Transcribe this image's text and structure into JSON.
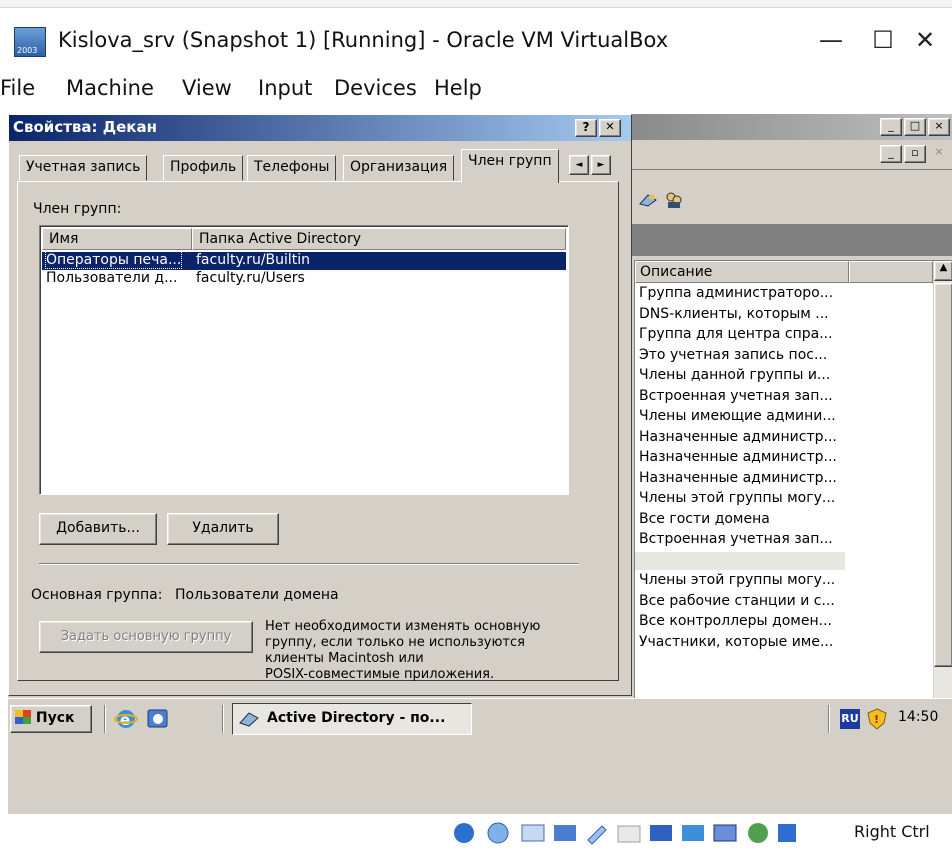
{
  "host": {
    "title": "Kislova_srv (Snapshot 1) [Running] - Oracle VM VirtualBox",
    "icon_year": "2003",
    "minimize": "—",
    "maximize": "☐",
    "close": "✕",
    "menu": [
      "File",
      "Machine",
      "View",
      "Input",
      "Devices",
      "Help"
    ],
    "right_ctrl": "Right Ctrl"
  },
  "dialog": {
    "title": "Свойства: Декан",
    "help_btn": "?",
    "close_btn": "✕",
    "tabs": [
      "Учетная запись",
      "Профиль",
      "Телефоны",
      "Организация",
      "Член групп"
    ],
    "tab_prev": "◄",
    "tab_next": "►",
    "member_label": "Член групп:",
    "columns": [
      "Имя",
      "Папка Active Directory"
    ],
    "rows": [
      {
        "name": "Операторы печа...",
        "folder": "faculty.ru/Builtin"
      },
      {
        "name": "Пользователи д...",
        "folder": "faculty.ru/Users"
      }
    ],
    "add_btn": "Добавить...",
    "remove_btn": "Удалить",
    "primary_group_label": "Основная группа:",
    "primary_group_value": "Пользователи домена",
    "set_primary_btn": "Задать основную группу",
    "note_lines": [
      "Нет необходимости изменять основную",
      "группу, если только не используются",
      "клиенты Macintosh или",
      "POSIX-совместимые приложения."
    ]
  },
  "bg_window": {
    "column": "Описание",
    "rows": [
      "Группа администраторо...",
      "DNS-клиенты, которым ...",
      "Группа для центра спра...",
      "Это учетная запись пос...",
      "Члены данной группы и...",
      "Встроенная учетная зап...",
      "Члены имеющие админи...",
      "Назначенные администр...",
      "Назначенные администр...",
      "Назначенные администр...",
      "Члены этой группы могу...",
      "Все гости домена",
      "Встроенная учетная зап...",
      "",
      "Члены этой группы могу...",
      "Все рабочие станции и с...",
      "Все контроллеры домен...",
      "Участники, которые име..."
    ]
  },
  "taskbar": {
    "start": "Пуск",
    "active_task": "Active Directory - по...",
    "lang": "RU",
    "clock": "14:50"
  }
}
